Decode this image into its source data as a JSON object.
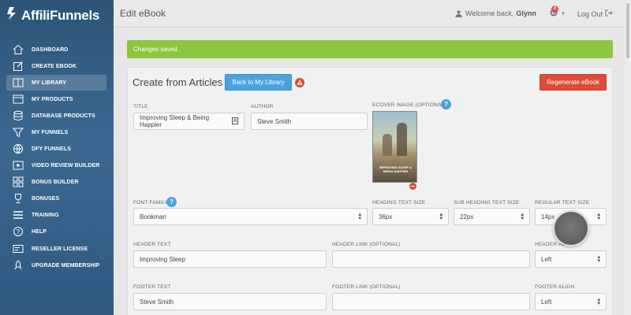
{
  "brand": {
    "logo_text": "AffiliFunnels"
  },
  "sidebar": {
    "items": [
      {
        "label": "DASHBOARD",
        "icon": "home-icon"
      },
      {
        "label": "CREATE EBOOK",
        "icon": "edit-icon"
      },
      {
        "label": "MY LIBRARY",
        "icon": "book-icon",
        "active": true
      },
      {
        "label": "MY PRODUCTS",
        "icon": "box-icon"
      },
      {
        "label": "DATABASE PRODUCTS",
        "icon": "database-icon"
      },
      {
        "label": "MY FUNNELS",
        "icon": "funnel-icon"
      },
      {
        "label": "DFY FUNNELS",
        "icon": "globe-icon"
      },
      {
        "label": "VIDEO REVIEW BUILDER",
        "icon": "video-icon"
      },
      {
        "label": "BONUS BUILDER",
        "icon": "grid-icon"
      },
      {
        "label": "BONUSES",
        "icon": "trophy-icon"
      },
      {
        "label": "TRAINING",
        "icon": "list-icon"
      },
      {
        "label": "HELP",
        "icon": "help-icon"
      },
      {
        "label": "RESELLER LICENSE",
        "icon": "license-icon"
      },
      {
        "label": "UPGRADE MEMBERSHIP",
        "icon": "rocket-icon"
      }
    ]
  },
  "header": {
    "title": "Edit eBook",
    "welcome_prefix": "Welcome back,",
    "user_name": "Glynn",
    "notification_count": "8",
    "logout_label": "Log Out"
  },
  "alert": {
    "message": "Changes saved."
  },
  "form": {
    "title": "Create from Articles",
    "back_button": "Back to My Library",
    "regenerate_button": "Regenerate eBook",
    "title_label": "TITLE",
    "title_value": "Improving Sleep & Being Happier",
    "author_label": "AUTHOR",
    "author_value": "Steve Smith",
    "cover_label": "ECOVER IMAGE (OPTIONAL)",
    "cover_title": "IMPROVING SLEEP & BEING HAPPIER",
    "font_family_label": "FONT FAMILY",
    "font_family_value": "Bookman",
    "heading_size_label": "HEADING TEXT SIZE",
    "heading_size_value": "36px",
    "subheading_size_label": "SUB HEADING TEXT SIZE",
    "subheading_size_value": "22px",
    "regular_size_label": "REGULAR TEXT SIZE",
    "regular_size_value": "14px",
    "header_text_label": "HEADER TEXT",
    "header_text_value": "Improving Sleep",
    "header_link_label": "HEADER LINK (OPTIONAL)",
    "header_link_value": "",
    "header_align_label": "HEADER AL",
    "header_align_value": "Left",
    "footer_text_label": "FOOTER TEXT",
    "footer_text_value": "Steve Smith",
    "footer_link_label": "FOOTER LINK (OPTIONAL)",
    "footer_link_value": "",
    "footer_align_label": "FOOTER ALIGN",
    "footer_align_value": "Left"
  },
  "colors": {
    "sidebar": "#3b6891",
    "success": "#8dc63f",
    "primary": "#4aa3df",
    "danger": "#dd4b39"
  }
}
